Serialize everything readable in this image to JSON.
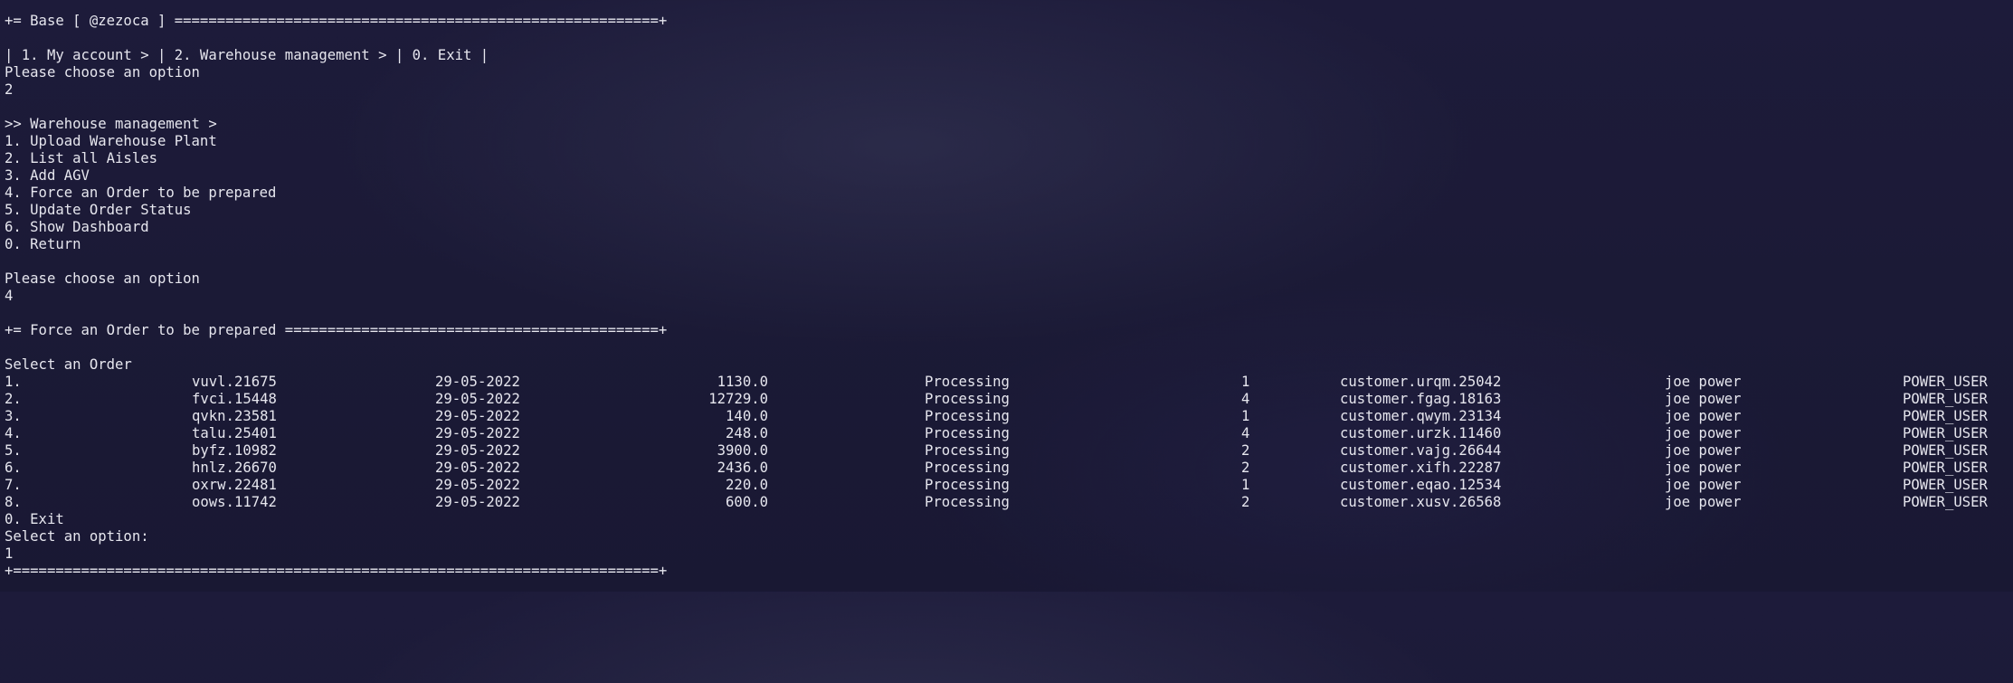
{
  "header": {
    "base_banner": "+= Base [ @zezoca ] =========================================================+",
    "nav_bar": "| 1. My account > | 2. Warehouse management > | 0. Exit |",
    "prompt1": "Please choose an option",
    "input1": "2"
  },
  "warehouse_menu": {
    "title": ">> Warehouse management >",
    "options": [
      "1. Upload Warehouse Plant",
      "2. List all Aisles",
      "3. Add AGV",
      "4. Force an Order to be prepared",
      "5. Update Order Status",
      "6. Show Dashboard",
      "0. Return"
    ],
    "prompt": "Please choose an option",
    "input": "4"
  },
  "force_order": {
    "banner": "+= Force an Order to be prepared ============================================+",
    "select_label": "Select an Order",
    "orders": [
      {
        "num": "1.",
        "code": "vuvl.21675",
        "date": "29-05-2022",
        "total": "1130.0",
        "status": "Processing",
        "qty": "1",
        "customer": "customer.urqm.25042",
        "name": "joe power",
        "role": "POWER_USER"
      },
      {
        "num": "2.",
        "code": "fvci.15448",
        "date": "29-05-2022",
        "total": "12729.0",
        "status": "Processing",
        "qty": "4",
        "customer": "customer.fgag.18163",
        "name": "joe power",
        "role": "POWER_USER"
      },
      {
        "num": "3.",
        "code": "qvkn.23581",
        "date": "29-05-2022",
        "total": "140.0",
        "status": "Processing",
        "qty": "1",
        "customer": "customer.qwym.23134",
        "name": "joe power",
        "role": "POWER_USER"
      },
      {
        "num": "4.",
        "code": "talu.25401",
        "date": "29-05-2022",
        "total": "248.0",
        "status": "Processing",
        "qty": "4",
        "customer": "customer.urzk.11460",
        "name": "joe power",
        "role": "POWER_USER"
      },
      {
        "num": "5.",
        "code": "byfz.10982",
        "date": "29-05-2022",
        "total": "3900.0",
        "status": "Processing",
        "qty": "2",
        "customer": "customer.vajg.26644",
        "name": "joe power",
        "role": "POWER_USER"
      },
      {
        "num": "6.",
        "code": "hnlz.26670",
        "date": "29-05-2022",
        "total": "2436.0",
        "status": "Processing",
        "qty": "2",
        "customer": "customer.xifh.22287",
        "name": "joe power",
        "role": "POWER_USER"
      },
      {
        "num": "7.",
        "code": "oxrw.22481",
        "date": "29-05-2022",
        "total": "220.0",
        "status": "Processing",
        "qty": "1",
        "customer": "customer.eqao.12534",
        "name": "joe power",
        "role": "POWER_USER"
      },
      {
        "num": "8.",
        "code": "oows.11742",
        "date": "29-05-2022",
        "total": "600.0",
        "status": "Processing",
        "qty": "2",
        "customer": "customer.xusv.26568",
        "name": "joe power",
        "role": "POWER_USER"
      }
    ],
    "exit_option": "0. Exit",
    "select_prompt": "Select an option:",
    "input": "1",
    "footer_banner": "+============================================================================+"
  }
}
